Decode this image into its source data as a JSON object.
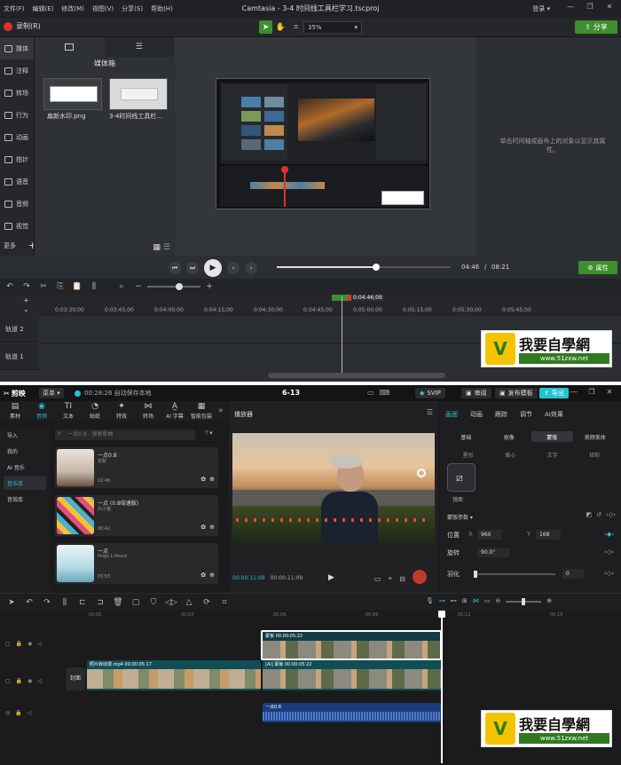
{
  "camtasia": {
    "menu": [
      "文件(F)",
      "编辑(E)",
      "修改(M)",
      "视图(V)",
      "分享(S)",
      "帮助(H)"
    ],
    "title": "Camtasia - 3-4 时间线工具栏学习.tscproj",
    "login": "登录 ▾",
    "record_label": "录制(R)",
    "zoom_value": "35%",
    "share_label": "分享",
    "sidebar": [
      "媒体",
      "注释",
      "转场",
      "行为",
      "动画",
      "指针",
      "语音",
      "音频",
      "视觉"
    ],
    "more_label": "更多",
    "media_bin_title": "媒体箱",
    "media_items": [
      "扁新水印.png",
      "3-4时间线工具栏..."
    ],
    "properties_hint": "单击时间轴或画布上的对象以显示其属性。",
    "time_current": "04:46",
    "time_total": "08:21",
    "progress": 0.57,
    "properties_label": "属性",
    "playhead_label": "0:04:46;09",
    "ruler_ticks": [
      "0:03:30;00",
      "0:03:45;00",
      "0:04:00;00",
      "0:04:15;00",
      "0:04:30;00",
      "0:04:45;00",
      "0:05:00;00",
      "0:05:15;00",
      "0:05:30;00",
      "0:05:45;00"
    ],
    "tracks": [
      "轨道 2",
      "轨道 1"
    ]
  },
  "capcut": {
    "app_name": "剪映",
    "menu_label": "菜单 ▾",
    "autosave": "00:28:26 自动保存本地",
    "project_title": "6-13",
    "svip_label": "SVIP",
    "review_label": "审阅",
    "publish_label": "发布模板",
    "export_label": "导出",
    "asset_tabs": [
      "素材",
      "音频",
      "文本",
      "贴纸",
      "特效",
      "转场",
      "AI 字幕",
      "智能包装"
    ],
    "categories": [
      "导入",
      "我的",
      "AI 音乐",
      "音乐库",
      "音效库"
    ],
    "search_placeholder": "一点0.8 - 搜索歌曲",
    "audio_items": [
      {
        "title": "一点0.8",
        "artist": "花梨",
        "duration": "02:46"
      },
      {
        "title": "一点 (0.8倍速版)",
        "artist": "白小鬼",
        "duration": "00:42"
      },
      {
        "title": "一点",
        "artist": "Hugo L.Peazz",
        "duration": "05:55"
      }
    ],
    "player_title": "播放器",
    "time_current": "00:00:11:09",
    "time_total": "00:00:11:09",
    "right_tabs": [
      "画面",
      "动画",
      "跟踪",
      "调节",
      "AI效果"
    ],
    "sub_tabs": [
      "基础",
      "抠像",
      "蒙版",
      "美颜美体"
    ],
    "mask_types": [
      "星形",
      "爱心",
      "文字",
      "矩形"
    ],
    "mask_selected": "镜面",
    "mask_params": "蒙版参数 ▾",
    "pos_label": "位置",
    "pos_x": "960",
    "pos_y": "168",
    "rot_label": "旋转",
    "rot_value": "90.0°",
    "feather_label": "羽化",
    "feather_value": "0",
    "ruler_ticks": [
      "00:00",
      "00:03",
      "00:06",
      "00:09",
      "00:12",
      "00:15"
    ],
    "clips": {
      "top": "蒙板  00:00:05:22",
      "main_a": "照片转动漫.mp4  00:00:05:17",
      "main_b": "[AI] 蒙板  00:00:05:22",
      "audio": "一点0.8"
    },
    "cover_label": "封面"
  },
  "watermark": {
    "brand": "我要自學網",
    "url": "www.51zxw.net"
  }
}
